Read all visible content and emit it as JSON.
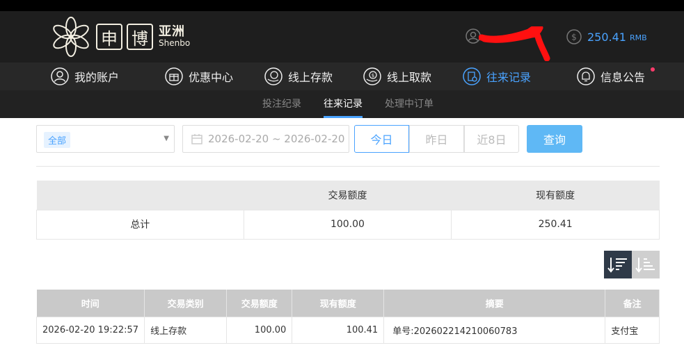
{
  "header": {
    "logo_char": "博",
    "logo_char0": "申",
    "logo_cn": "亚洲",
    "logo_en": "Shenbo",
    "balance": "250.41",
    "currency": "RMB"
  },
  "nav": {
    "items": [
      {
        "label": "我的账户",
        "icon": "user-circle-icon"
      },
      {
        "label": "优惠中心",
        "icon": "gift-icon"
      },
      {
        "label": "线上存款",
        "icon": "deposit-coin-icon"
      },
      {
        "label": "线上取款",
        "icon": "withdraw-coin-icon"
      },
      {
        "label": "往来记录",
        "icon": "record-icon",
        "active": true
      },
      {
        "label": "信息公告",
        "icon": "bell-icon"
      }
    ]
  },
  "subnav": {
    "items": [
      "投注纪录",
      "往来记录",
      "处理中订单"
    ],
    "active": "往来记录"
  },
  "filters": {
    "type_tag": "全部",
    "date_range": "2026-02-20 ~ 2026-02-20",
    "quick_buttons": [
      "今日",
      "昨日",
      "近8日"
    ],
    "query_label": "查询"
  },
  "summary": {
    "headers": [
      "",
      "交易额度",
      "现有额度"
    ],
    "row": [
      "总计",
      "100.00",
      "250.41"
    ]
  },
  "detail": {
    "headers": [
      "时间",
      "交易类别",
      "交易额度",
      "现有额度",
      "摘要",
      "备注"
    ],
    "rows": [
      [
        "2026-02-20 19:22:57",
        "线上存款",
        "100.00",
        "100.41",
        "单号:202602214210060783",
        "支付宝"
      ]
    ]
  },
  "colors": {
    "accent": "#4aa3ff",
    "query_button": "#5fb8f5",
    "header_bg": "#1e1e1e"
  }
}
